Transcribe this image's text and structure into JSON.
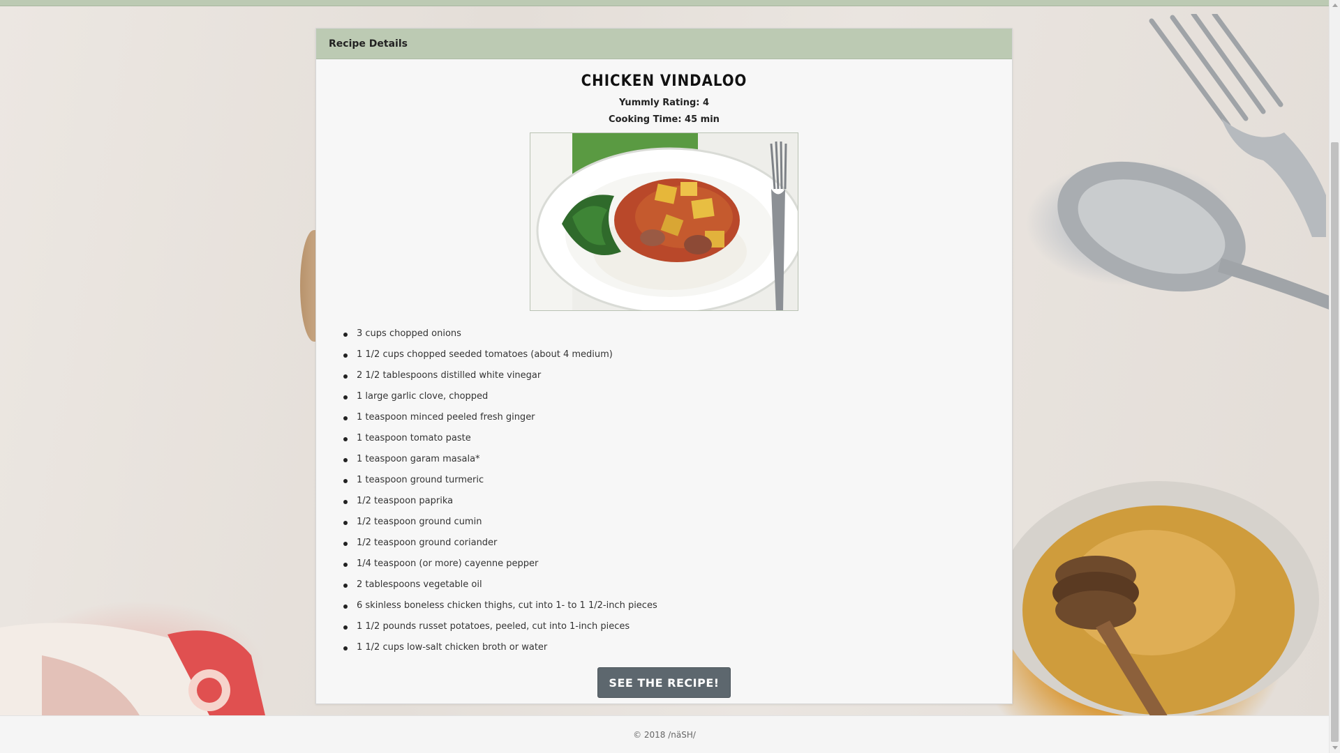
{
  "card": {
    "header_title": "Recipe Details",
    "recipe_title": "CHICKEN VINDALOO",
    "yummly_rating": "Yummly Rating: 4",
    "cooking_time": "Cooking Time: 45 min",
    "ingredients": [
      "3 cups chopped onions",
      "1 1/2 cups chopped seeded tomatoes (about 4 medium)",
      "2 1/2 tablespoons distilled white vinegar",
      "1 large garlic clove, chopped",
      "1 teaspoon minced peeled fresh ginger",
      "1 teaspoon tomato paste",
      "1 teaspoon garam masala*",
      "1 teaspoon ground turmeric",
      "1/2 teaspoon paprika",
      "1/2 teaspoon ground cumin",
      "1/2 teaspoon ground coriander",
      "1/4 teaspoon (or more) cayenne pepper",
      "2 tablespoons vegetable oil",
      "6 skinless boneless chicken thighs, cut into 1- to 1 1/2-inch pieces",
      "1 1/2 pounds russet potatoes, peeled, cut into 1-inch pieces",
      "1 1/2 cups low-salt chicken broth or water"
    ],
    "button_label": "SEE THE RECIPE!"
  },
  "footer": {
    "copyright": "© 2018 /näSH/"
  },
  "colors": {
    "header_bg": "#bccab3",
    "button_bg": "#5d676e",
    "card_bg": "#f7f7f7"
  }
}
